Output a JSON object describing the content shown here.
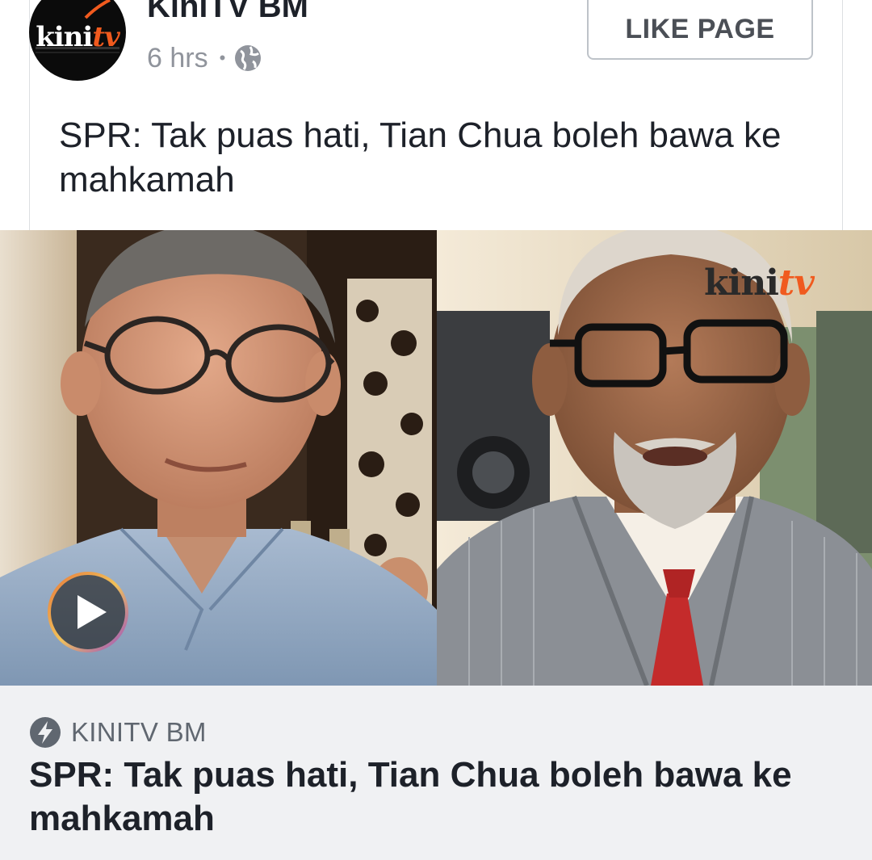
{
  "post": {
    "page_name": "KiniTV BM",
    "timestamp": "6 hrs",
    "separator": "•",
    "privacy_icon": "globe-icon",
    "like_button_label": "LIKE PAGE",
    "text": "SPR: Tak puas hati, Tian Chua boleh bawa ke mahkamah",
    "avatar_logo": {
      "main": "kini",
      "accent": "tv"
    }
  },
  "media": {
    "watermark": {
      "main": "kini",
      "accent": "tv"
    },
    "play_icon": "play-icon"
  },
  "link_preview": {
    "source_icon": "lightning-bolt-icon",
    "source": "KINITV BM",
    "title": "SPR: Tak puas hati, Tian Chua boleh bawa ke mahkamah"
  },
  "colors": {
    "brand_accent": "#f05a1e",
    "text_primary": "#1d2129",
    "text_secondary": "#90949c",
    "preview_background": "#f0f1f3"
  }
}
